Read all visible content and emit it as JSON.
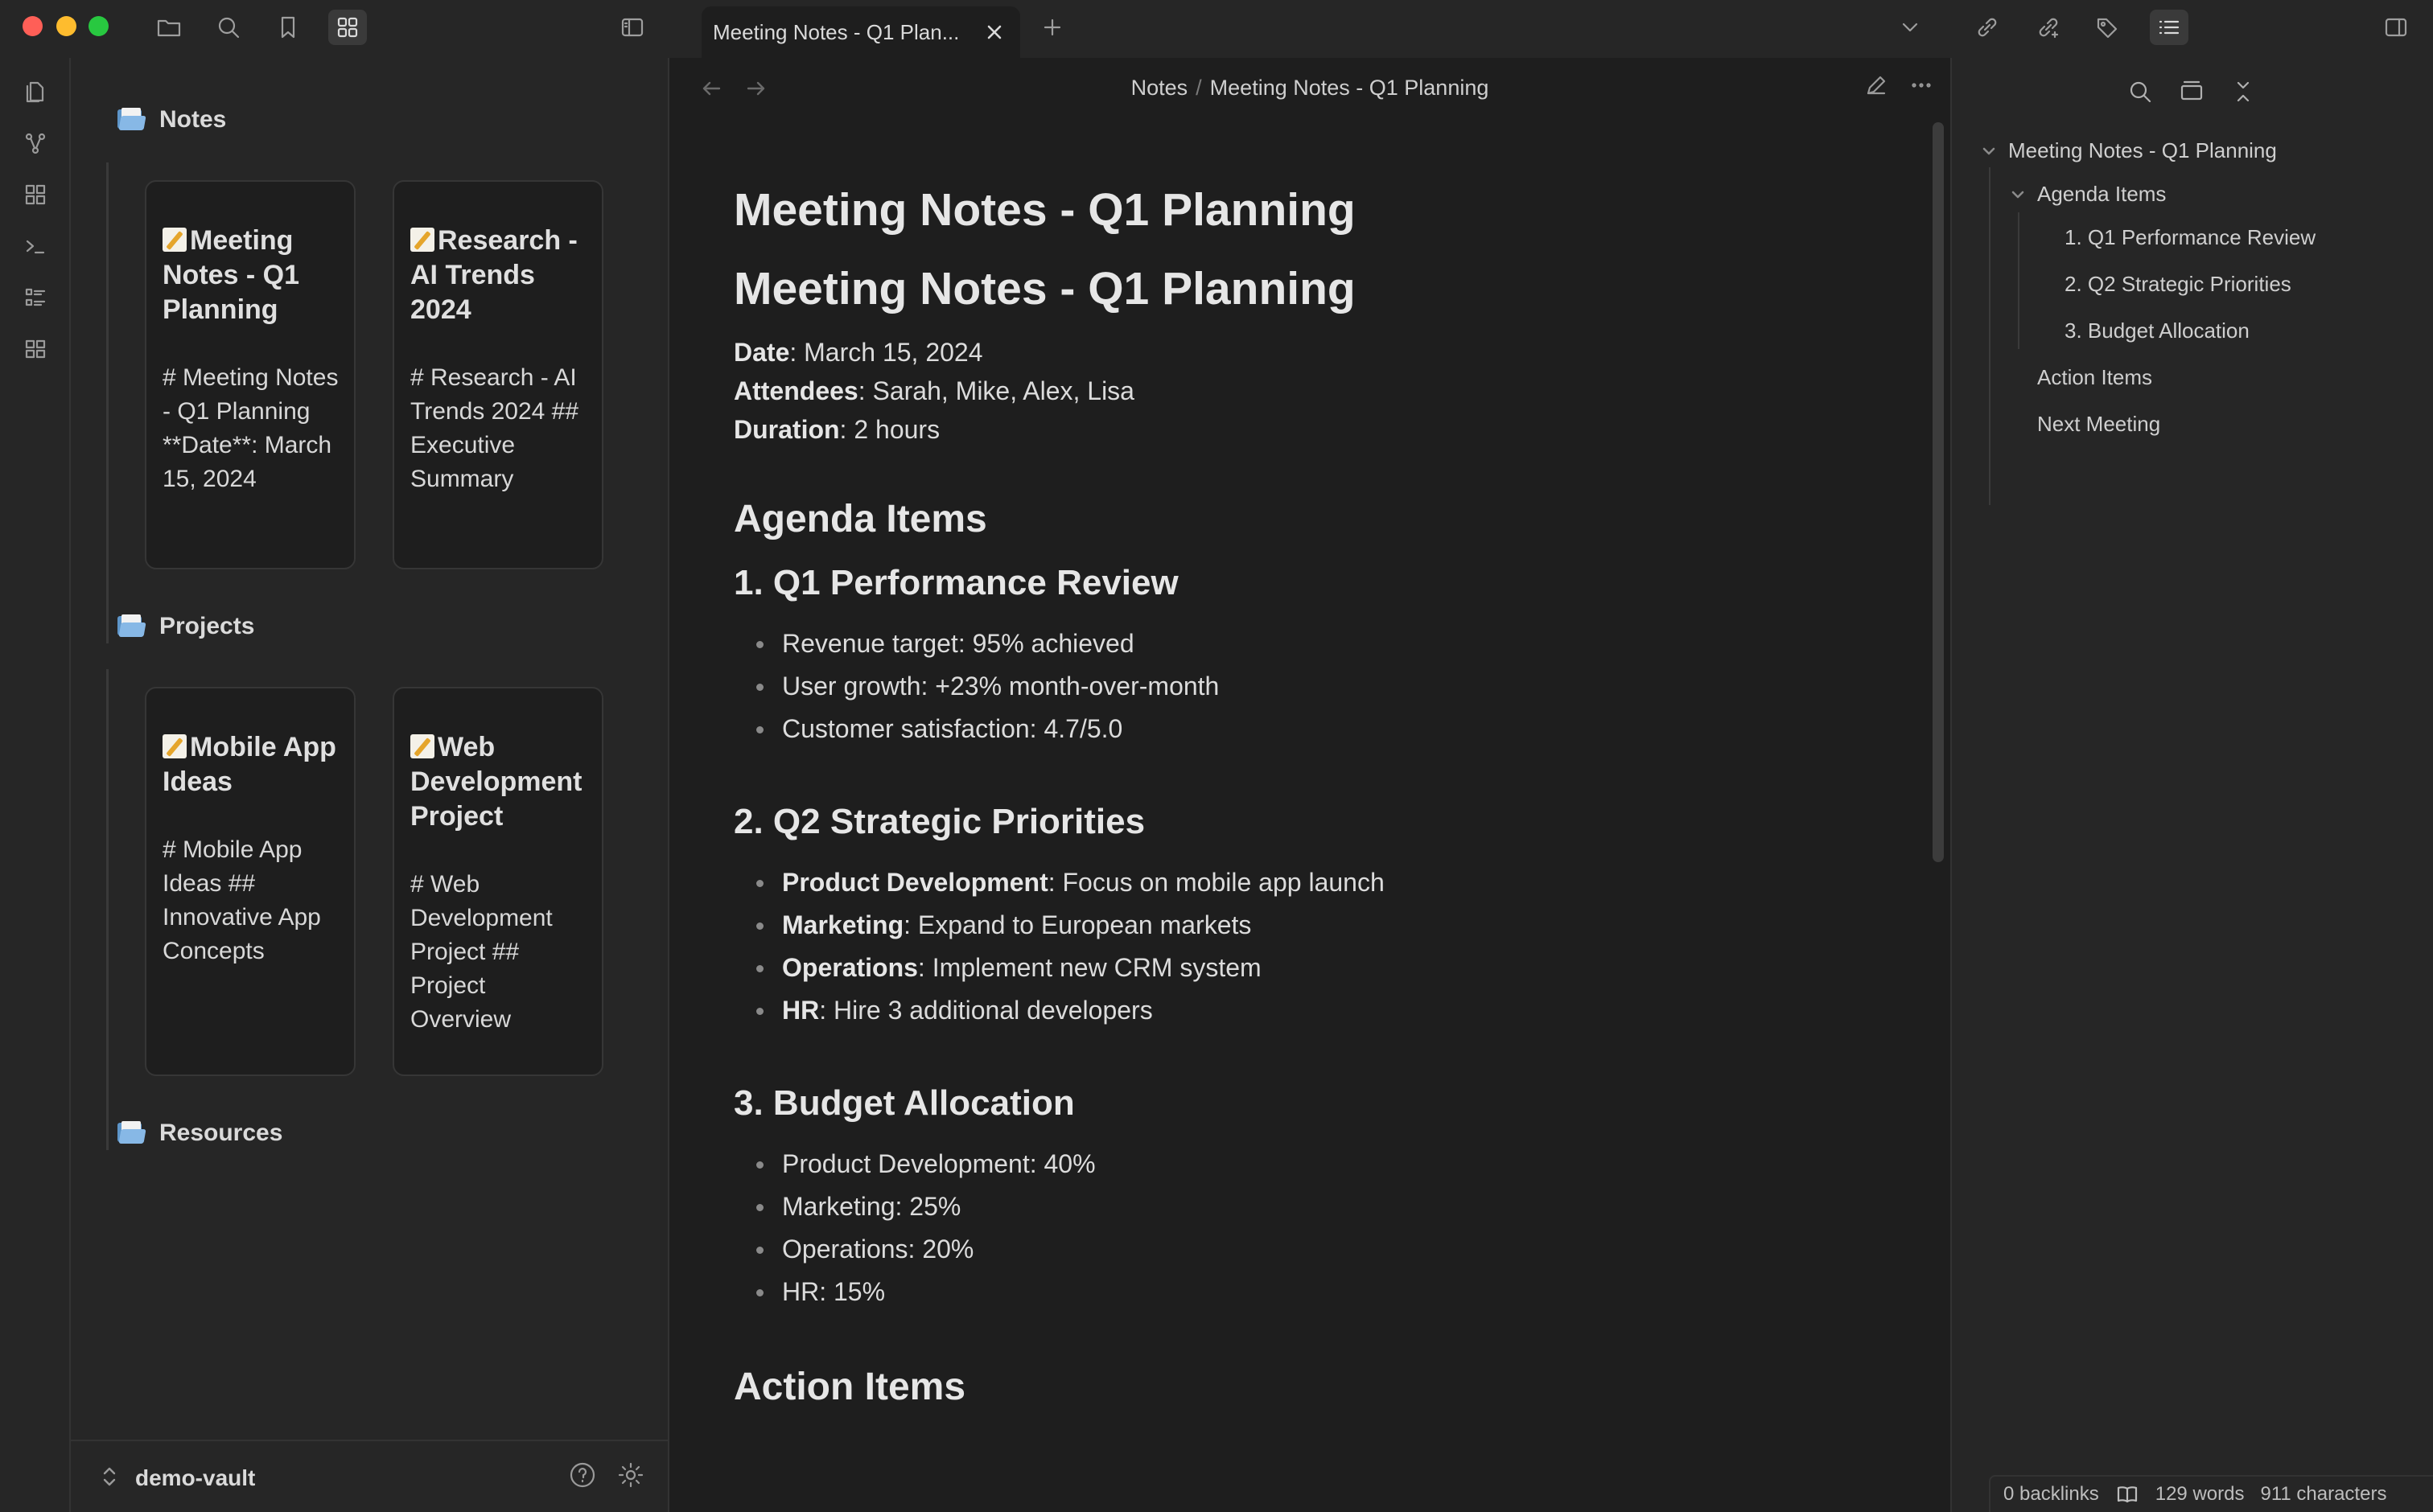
{
  "window": {
    "tab_title": "Meeting Notes - Q1 Plan..."
  },
  "titlebar_icons": [
    "folder-icon",
    "search-icon",
    "bookmark-icon",
    "grid-icon",
    "sidebar-toggle-icon",
    "plus-icon",
    "chevron-down-icon",
    "link-icon",
    "link-out-icon",
    "tags-icon",
    "list-icon",
    "right-sidebar-icon"
  ],
  "ribbon_icons": [
    "files-icon",
    "graph-icon",
    "canvas-icon",
    "terminal-icon",
    "outline-list-icon",
    "apps-grid-icon"
  ],
  "sidebar": {
    "folders": [
      {
        "name": "Notes",
        "cards": [
          {
            "title": "Meeting Notes - Q1 Planning",
            "excerpt": "# Meeting Notes - Q1 Planning **Date**: March 15, 2024"
          },
          {
            "title": "Research - AI Trends 2024",
            "excerpt": "# Research - AI Trends 2024 ## Executive Summary"
          }
        ]
      },
      {
        "name": "Projects",
        "cards": [
          {
            "title": "Mobile App Ideas",
            "excerpt": "# Mobile App Ideas ## Innovative App Concepts"
          },
          {
            "title": "Web Development Project",
            "excerpt": "# Web Development Project ## Project Overview"
          }
        ]
      },
      {
        "name": "Resources",
        "cards": []
      }
    ],
    "vault_name": "demo-vault"
  },
  "editor": {
    "breadcrumb": {
      "parent": "Notes",
      "separator": "/",
      "current": "Meeting Notes - Q1 Planning"
    },
    "title_inline": "Meeting Notes - Q1 Planning",
    "h1": "Meeting Notes - Q1 Planning",
    "meta": [
      {
        "key": "Date",
        "value": ": March 15, 2024"
      },
      {
        "key": "Attendees",
        "value": ": Sarah, Mike, Alex, Lisa"
      },
      {
        "key": "Duration",
        "value": ": 2 hours"
      }
    ],
    "agenda_heading": "Agenda Items",
    "sections": [
      {
        "heading": "1. Q1 Performance Review",
        "items": [
          {
            "bold": "",
            "text": "Revenue target: 95% achieved"
          },
          {
            "bold": "",
            "text": "User growth: +23% month-over-month"
          },
          {
            "bold": "",
            "text": "Customer satisfaction: 4.7/5.0"
          }
        ]
      },
      {
        "heading": "2. Q2 Strategic Priorities",
        "items": [
          {
            "bold": "Product Development",
            "text": ": Focus on mobile app launch"
          },
          {
            "bold": "Marketing",
            "text": ": Expand to European markets"
          },
          {
            "bold": "Operations",
            "text": ": Implement new CRM system"
          },
          {
            "bold": "HR",
            "text": ": Hire 3 additional developers"
          }
        ]
      },
      {
        "heading": "3. Budget Allocation",
        "items": [
          {
            "bold": "",
            "text": "Product Development: 40%"
          },
          {
            "bold": "",
            "text": "Marketing: 25%"
          },
          {
            "bold": "",
            "text": "Operations: 20%"
          },
          {
            "bold": "",
            "text": "HR: 15%"
          }
        ]
      }
    ],
    "action_heading": "Action Items"
  },
  "outline": {
    "root": "Meeting Notes - Q1 Planning",
    "agenda": "Agenda Items",
    "sub": [
      "1. Q1 Performance Review",
      "2. Q2 Strategic Priorities",
      "3. Budget Allocation"
    ],
    "action": "Action Items",
    "next": "Next Meeting"
  },
  "status": {
    "backlinks": "0 backlinks",
    "words": "129 words",
    "characters": "911 characters"
  },
  "colors": {
    "background": "#1e1e1e",
    "panel": "#262626",
    "text": "#dadada"
  }
}
